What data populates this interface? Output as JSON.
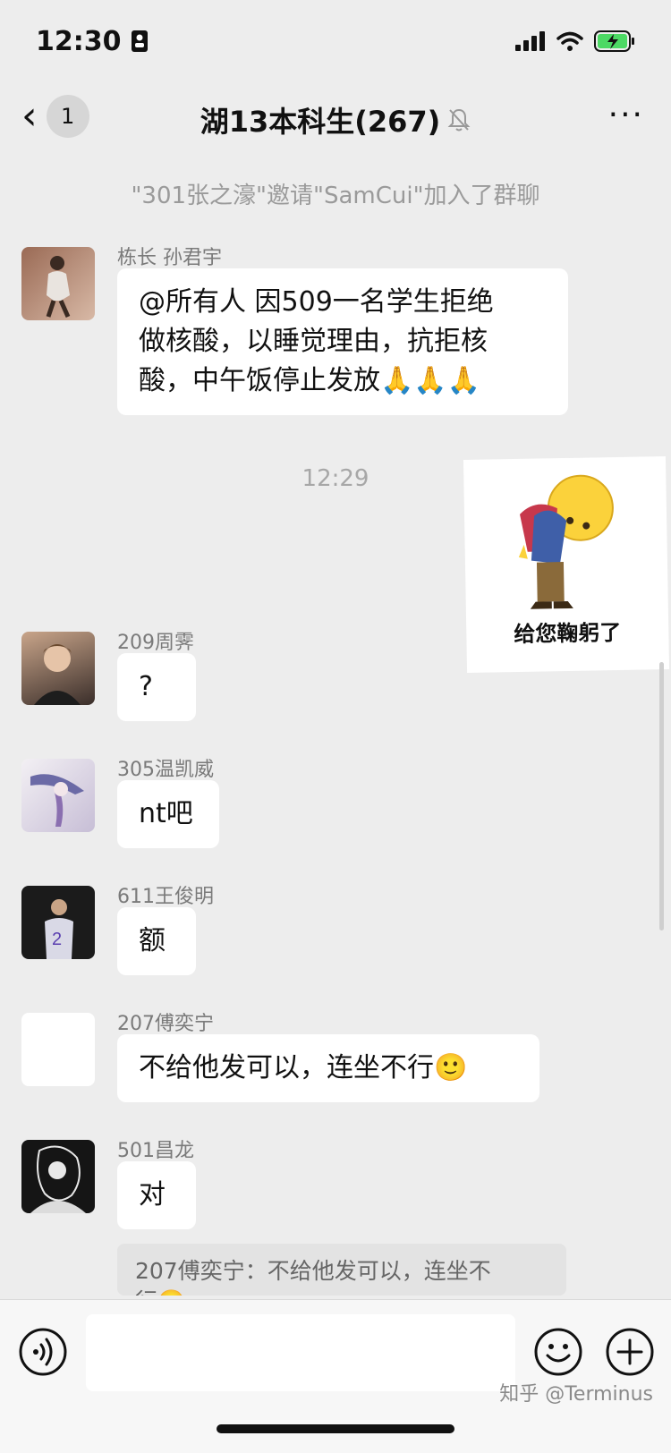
{
  "status_bar": {
    "time": "12:30"
  },
  "nav": {
    "back_count": "1",
    "title": "湖13本科生(267)",
    "more": "···"
  },
  "system_message": "\"301张之濠\"邀请\"SamCui\"加入了群聊",
  "timestamp": "12:29",
  "messages": [
    {
      "sender": "栋长 孙君宇",
      "line1": "@所有人 因509一名学生拒绝",
      "line2": "做核酸，以睡觉理由，抗拒核",
      "line3": "酸，中午饭停止发放🙏🙏🙏"
    },
    {
      "sender": "209周霁",
      "text": "?"
    },
    {
      "sender": "305温凯威",
      "text": "nt吧"
    },
    {
      "sender": "611王俊明",
      "text": "额"
    },
    {
      "sender": "207傅奕宁",
      "text": "不给他发可以，连坐不行🙂"
    },
    {
      "sender": "501昌龙",
      "text": "对"
    }
  ],
  "quote": {
    "line1": "207傅奕宁：不给他发可以，连坐不",
    "line2": "行🙂"
  },
  "sticker": {
    "caption": "给您鞠躬了"
  },
  "watermark": "知乎 @Terminus",
  "colors": {
    "background": "#ededed",
    "bubble": "#ffffff",
    "input_bar": "#f7f7f7"
  }
}
